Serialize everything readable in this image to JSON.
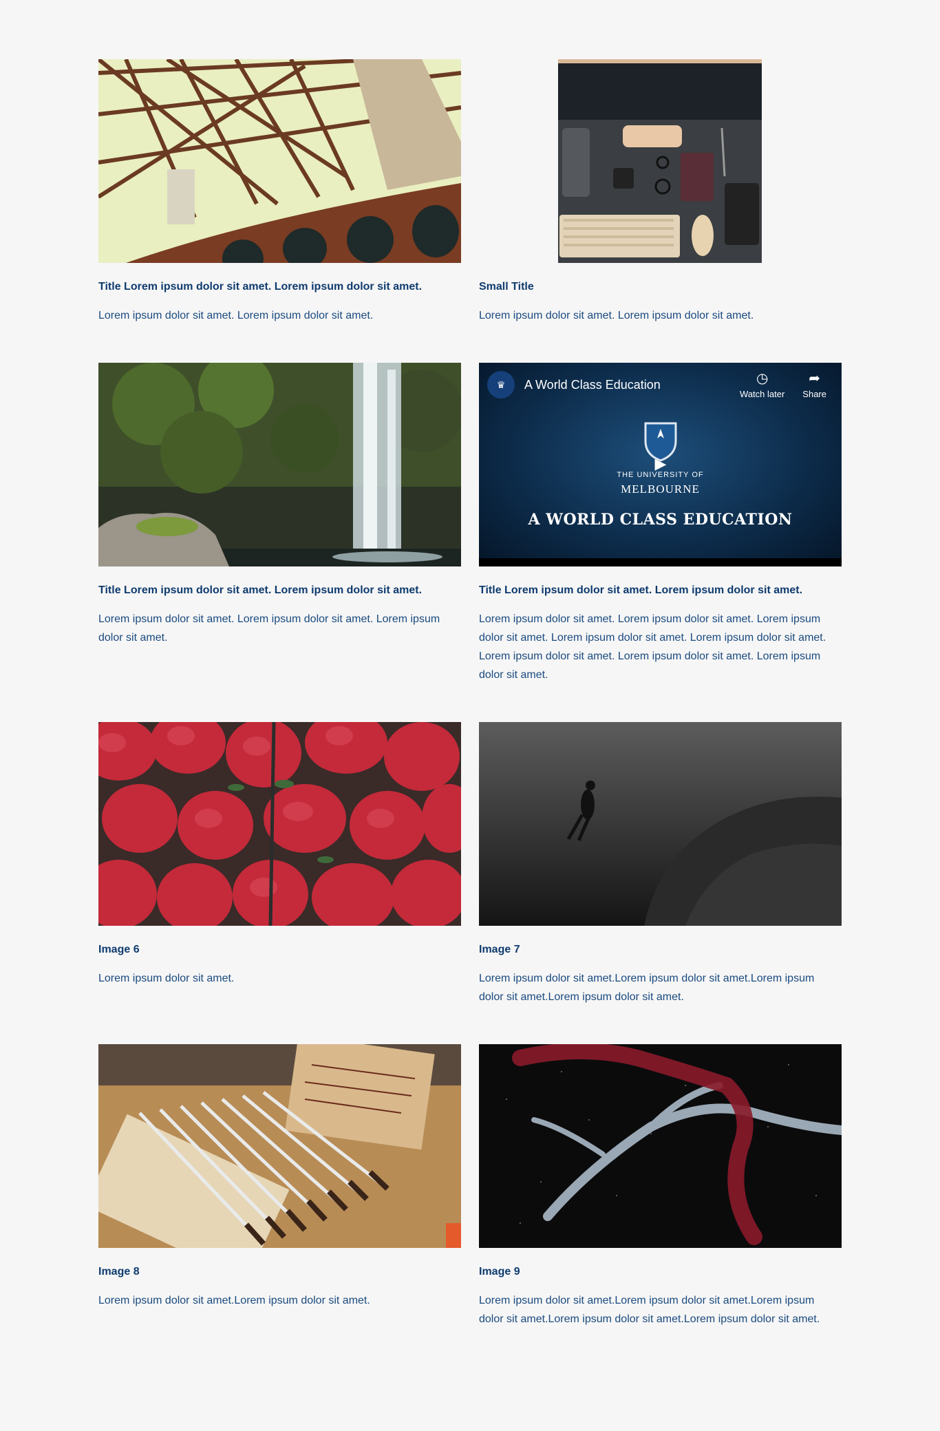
{
  "cards": [
    {
      "title": "Title Lorem ipsum dolor sit amet. Lorem ipsum dolor sit amet.",
      "description": "Lorem ipsum dolor sit amet. Lorem ipsum dolor sit amet."
    },
    {
      "title": "Small Title",
      "description": "Lorem ipsum dolor sit amet. Lorem ipsum dolor sit amet."
    },
    {
      "title": "Title Lorem ipsum dolor sit amet. Lorem ipsum dolor sit amet.",
      "description": "Lorem ipsum dolor sit amet. Lorem ipsum dolor sit amet. Lorem ipsum dolor sit amet."
    },
    {
      "title": "Title Lorem ipsum dolor sit amet. Lorem ipsum dolor sit amet.",
      "description": "Lorem ipsum dolor sit amet. Lorem ipsum dolor sit amet. Lorem ipsum dolor sit amet. Lorem ipsum dolor sit amet. Lorem ipsum dolor sit amet. Lorem ipsum dolor sit amet. Lorem ipsum dolor sit amet. Lorem ipsum dolor sit amet.",
      "video": {
        "title": "A World Class Education",
        "watch_later": "Watch later",
        "share": "Share",
        "uni_line1": "THE UNIVERSITY OF",
        "uni_line2": "MELBOURNE",
        "caption": "A WORLD CLASS EDUCATION"
      }
    },
    {
      "title": "Image 6",
      "description": "Lorem ipsum dolor sit amet."
    },
    {
      "title": "Image 7",
      "description": "Lorem ipsum dolor sit amet.Lorem ipsum dolor sit amet.Lorem ipsum dolor sit amet.Lorem ipsum dolor sit amet."
    },
    {
      "title": "Image 8",
      "description": "Lorem ipsum dolor sit amet.Lorem ipsum dolor sit amet."
    },
    {
      "title": "Image 9",
      "description": "Lorem ipsum dolor sit amet.Lorem ipsum dolor sit amet.Lorem ipsum dolor sit amet.Lorem ipsum dolor sit amet.Lorem ipsum dolor sit amet."
    }
  ],
  "colors": {
    "background": "#f6f6f6",
    "title": "#0f3b6e",
    "text": "#1a4a7f"
  }
}
